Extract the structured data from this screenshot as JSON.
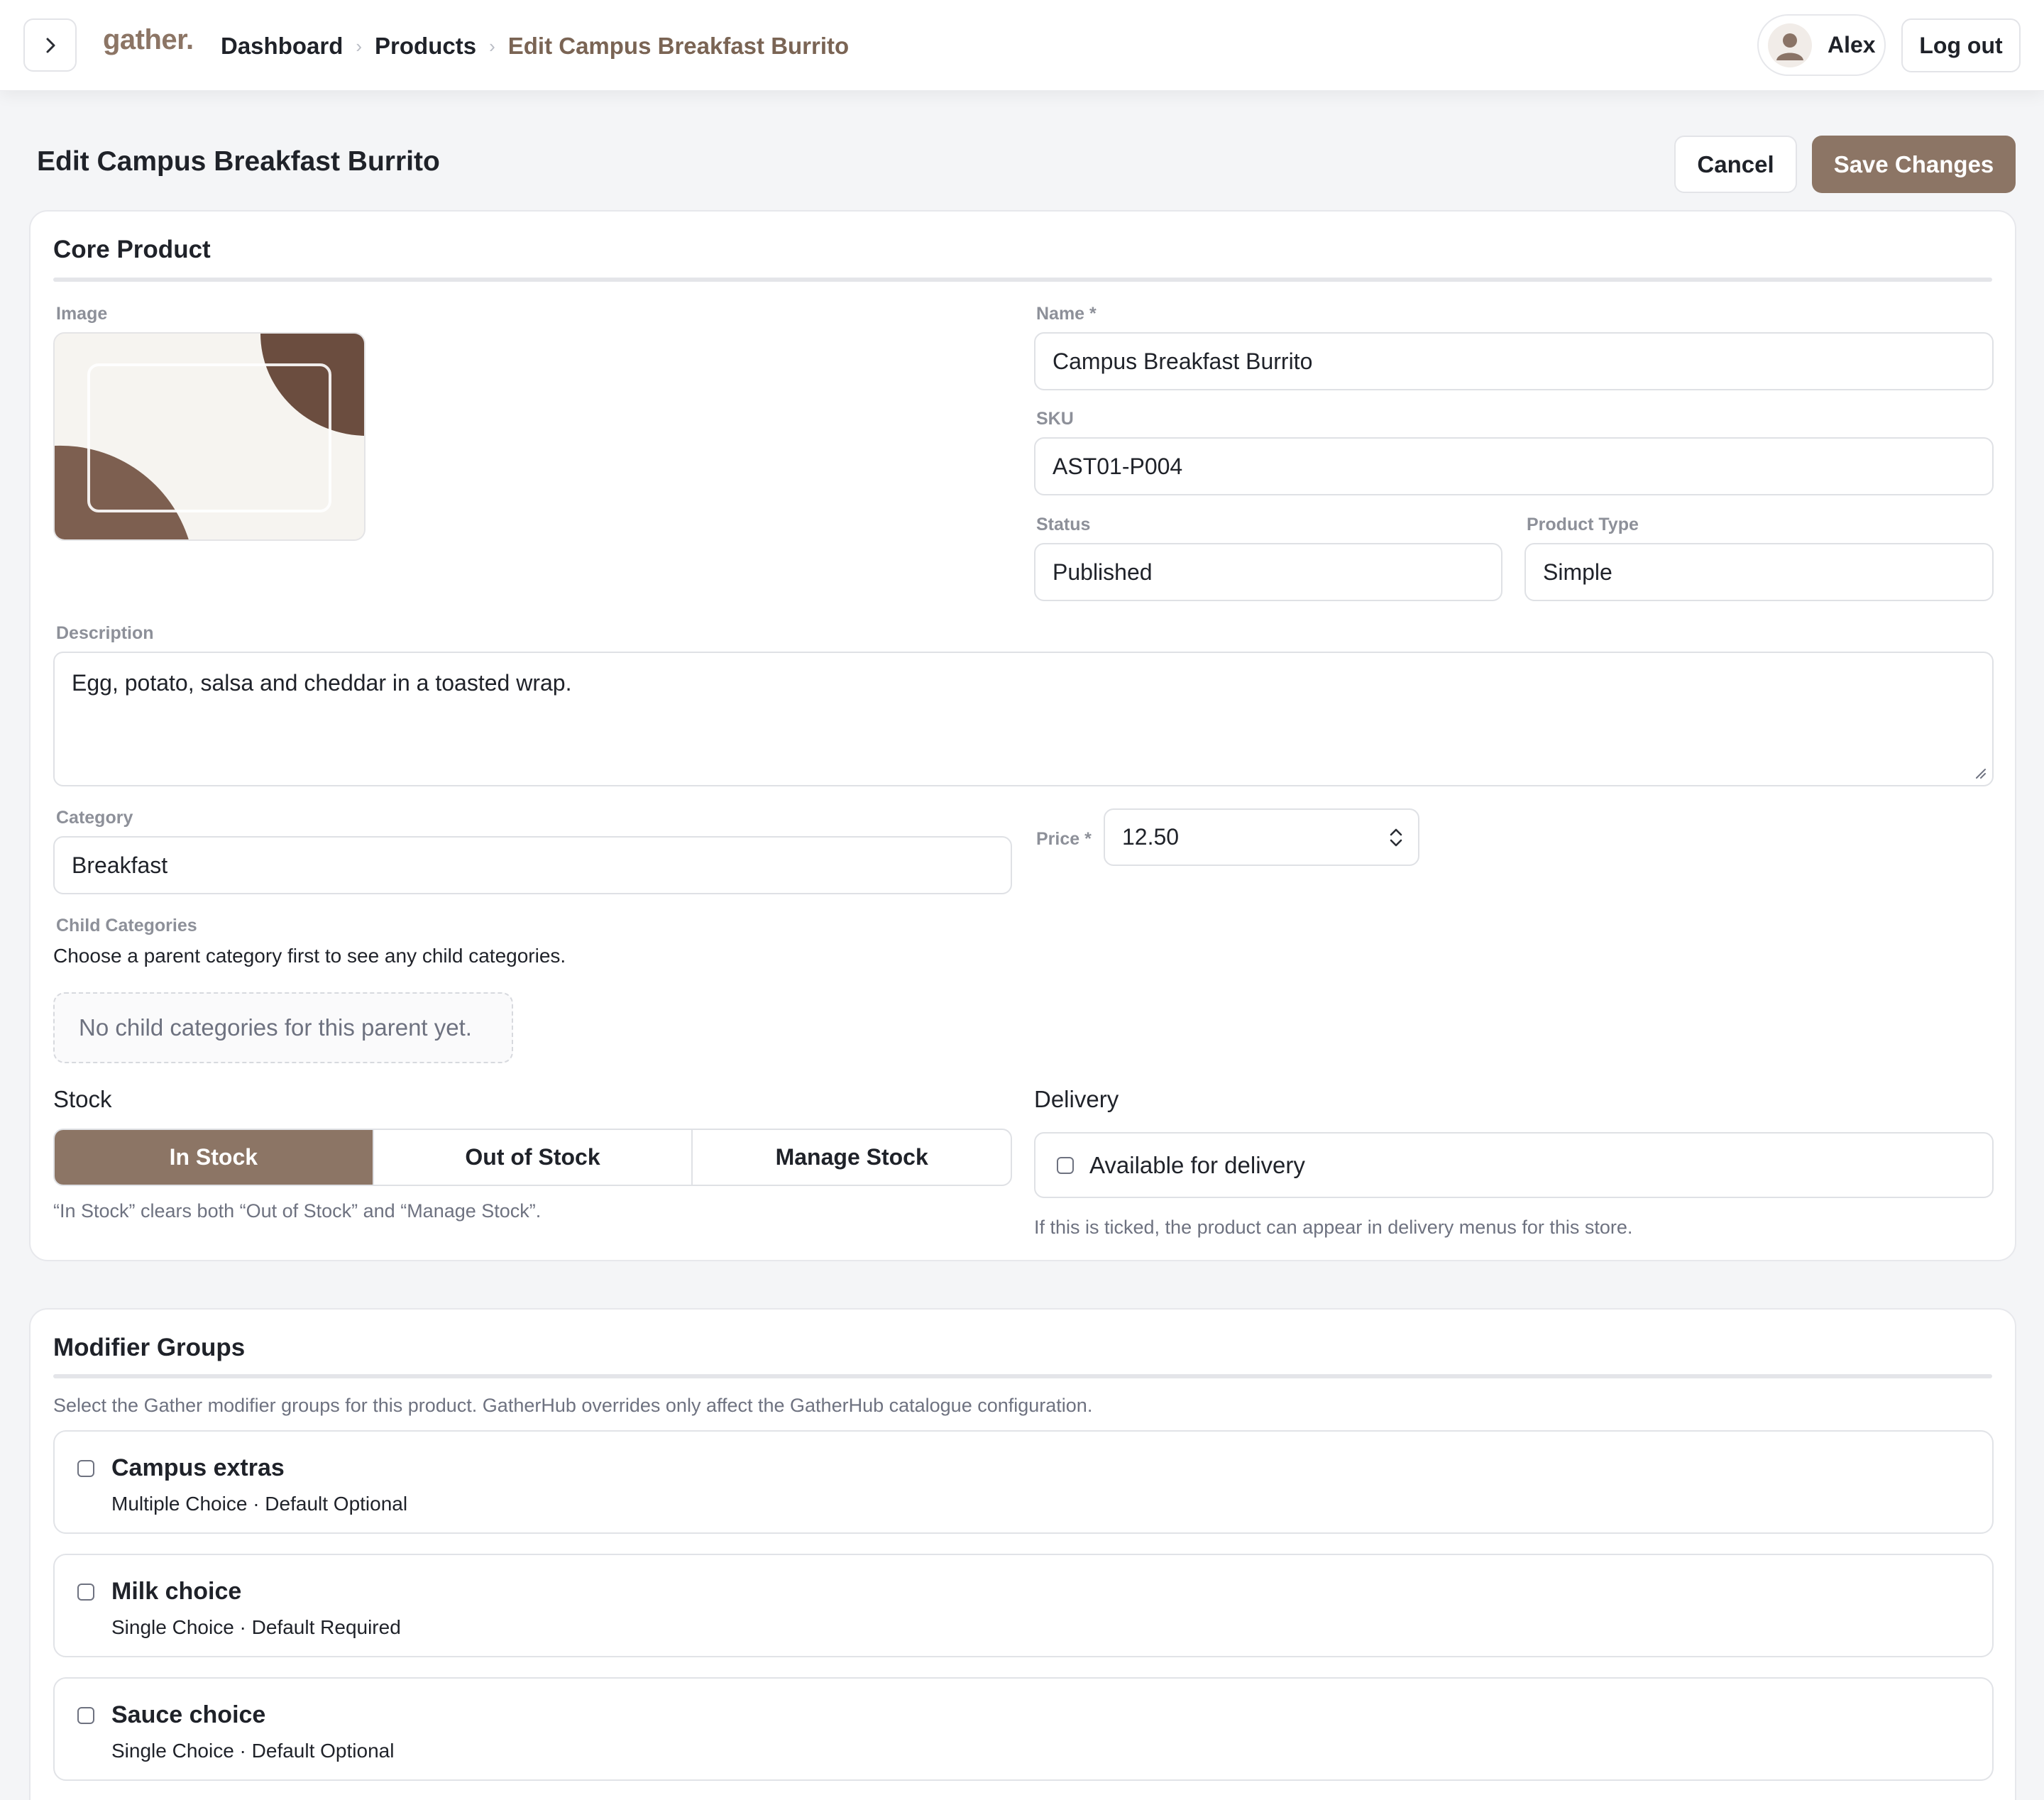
{
  "header": {
    "logo": "gather.",
    "breadcrumbs": [
      {
        "label": "Dashboard"
      },
      {
        "label": "Products"
      },
      {
        "label": "Edit Campus Breakfast Burrito"
      }
    ],
    "separator": "›",
    "user": {
      "name": "Alex"
    },
    "logout_label": "Log out"
  },
  "page": {
    "title": "Edit Campus Breakfast Burrito",
    "cancel_label": "Cancel",
    "save_label": "Save Changes"
  },
  "core": {
    "title": "Core Product",
    "image_label": "Image",
    "name_label": "Name *",
    "name_value": "Campus Breakfast Burrito",
    "sku_label": "SKU",
    "sku_value": "AST01-P004",
    "status_label": "Status",
    "status_value": "Published",
    "type_label": "Product Type",
    "type_value": "Simple",
    "description_label": "Description",
    "description_value": "Egg, potato, salsa and cheddar in a toasted wrap.",
    "category_label": "Category",
    "category_value": "Breakfast",
    "price_label": "Price *",
    "price_value": "12.50",
    "child_label": "Child Categories",
    "child_help": "Choose a parent category first to see any child categories.",
    "child_empty": "No child categories for this parent yet.",
    "stock_label": "Stock",
    "stock_options": [
      {
        "label": "In Stock",
        "active": true
      },
      {
        "label": "Out of Stock",
        "active": false
      },
      {
        "label": "Manage Stock",
        "active": false
      }
    ],
    "stock_help": "“In Stock” clears both “Out of Stock” and “Manage Stock”.",
    "delivery_label": "Delivery",
    "delivery_checkbox": "Available for delivery",
    "delivery_checked": false,
    "delivery_help": "If this is ticked, the product can appear in delivery menus for this store."
  },
  "modifiers": {
    "title": "Modifier Groups",
    "description": "Select the Gather modifier groups for this product. GatherHub overrides only affect the GatherHub catalogue configuration.",
    "groups": [
      {
        "name": "Campus extras",
        "meta": "Multiple Choice · Default Optional",
        "checked": false
      },
      {
        "name": "Milk choice",
        "meta": "Single Choice · Default Required",
        "checked": false
      },
      {
        "name": "Sauce choice",
        "meta": "Single Choice · Default Optional",
        "checked": false
      }
    ]
  },
  "colors": {
    "accent": "#8c7565",
    "accent_dark": "#6b4d3f",
    "background": "#f4f5f7"
  },
  "icons": {
    "sidebar_toggle": "chevron-right-icon",
    "avatar": "user-avatar-icon",
    "spinner": "up-down-stepper-icon",
    "resize": "resize-grip-icon"
  }
}
